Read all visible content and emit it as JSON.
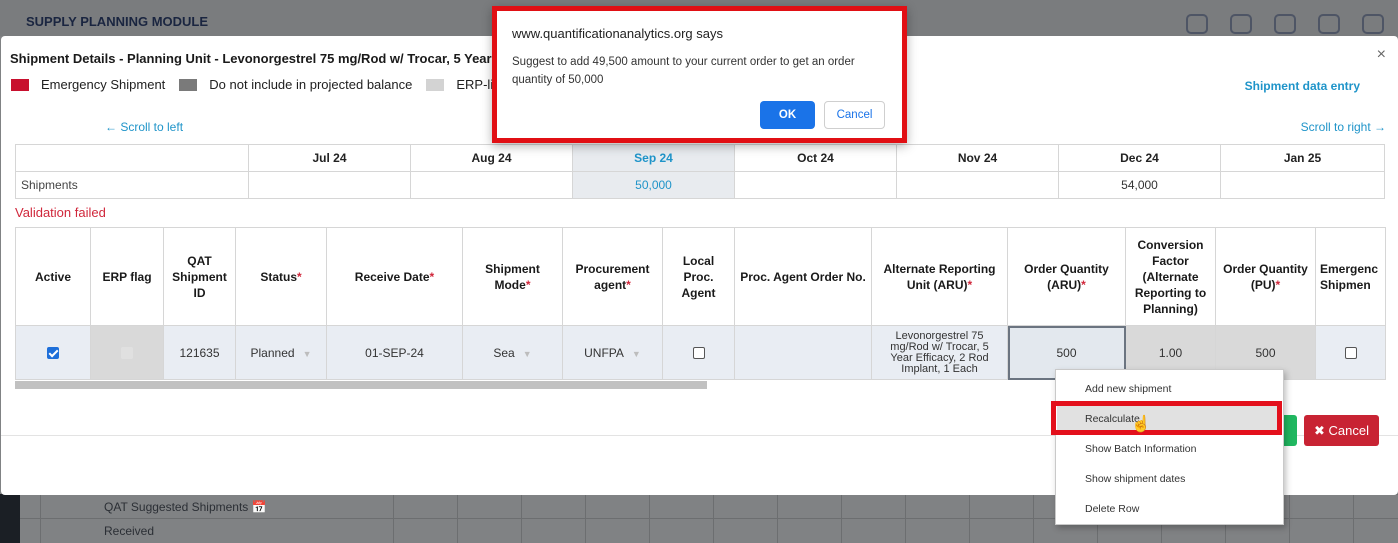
{
  "background": {
    "module_title": "SUPPLY PLANNING MODULE",
    "rows": [
      "QAT Suggested Shipments",
      "Received"
    ]
  },
  "modal": {
    "title": "Shipment Details - Planning Unit - Levonorgestrel 75 mg/Rod w/ Trocar, 5 Year Ef",
    "legend": [
      {
        "label": "Emergency Shipment",
        "color": "#c8102e"
      },
      {
        "label": "Do not include in projected balance",
        "color": "#7a7a7a"
      },
      {
        "label": "ERP-linl",
        "color": "#d3d3d3"
      }
    ],
    "shipment_data_entry": "Shipment data entry",
    "scroll_left": "← Scroll to left",
    "scroll_right": "Scroll to right →",
    "months": [
      "Jul 24",
      "Aug 24",
      "Sep 24",
      "Oct 24",
      "Nov 24",
      "Dec 24",
      "Jan 25"
    ],
    "shipments_label": "Shipments",
    "shipments_values": [
      "",
      "",
      "50,000",
      "",
      "",
      "54,000",
      ""
    ],
    "validation": "Validation failed",
    "columns": {
      "active": "Active",
      "erp_flag": "ERP flag",
      "qat_id": "QAT Shipment ID",
      "status": "Status",
      "receive_date": "Receive Date",
      "mode": "Shipment Mode",
      "agent": "Procurement agent",
      "local": "Local Proc. Agent",
      "order_no": "Proc. Agent Order No.",
      "aru": "Alternate Reporting Unit (ARU)",
      "qty_aru": "Order Quantity (ARU)",
      "conversion": "Conversion Factor (Alternate Reporting to Planning)",
      "qty_pu": "Order Quantity (PU)",
      "emergency": "Emergenc Shipmen"
    },
    "row": {
      "qat_id": "121635",
      "status": "Planned",
      "receive_date": "01-SEP-24",
      "mode": "Sea",
      "agent": "UNFPA",
      "aru": "Levonorgestrel 75 mg/Rod w/ Trocar, 5 Year Efficacy, 2 Rod Implant, 1 Each",
      "qty_aru": "500",
      "conversion": "1.00",
      "qty_pu": "500"
    },
    "cancel_label": "✖ Cancel"
  },
  "context_menu": {
    "items": [
      "Add new shipment",
      "Recalculate",
      "Show Batch Information",
      "Show shipment dates",
      "Delete Row"
    ]
  },
  "alert": {
    "origin": "www.quantificationanalytics.org says",
    "message": "Suggest to add 49,500 amount to your current order to get an order quantity of 50,000",
    "ok": "OK",
    "cancel": "Cancel"
  }
}
